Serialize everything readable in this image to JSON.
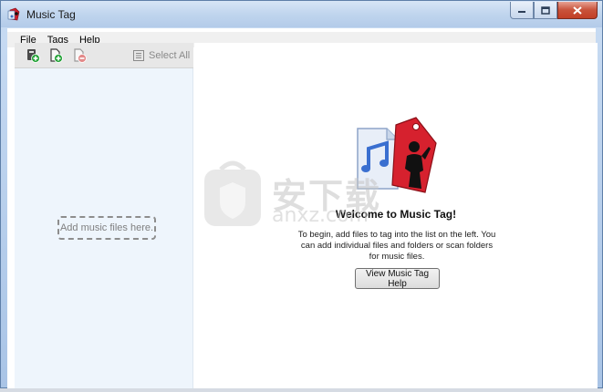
{
  "window": {
    "title": "Music Tag",
    "accent_color": "#b3cbe9",
    "close_color": "#c8523a"
  },
  "menu": {
    "items": [
      "File",
      "Tags",
      "Help"
    ]
  },
  "toolbar": {
    "icons": [
      "add-file-icon",
      "add-folder-icon",
      "remove-file-icon"
    ],
    "select_all_label": "Select All"
  },
  "left_pane": {
    "placeholder": "Add music files here."
  },
  "right_pane": {
    "welcome_title": "Welcome to Music Tag!",
    "description": "To begin, add files to tag into the list on the left. You can add individual files and folders or scan folders for music files.",
    "help_button": "View Music Tag Help"
  },
  "watermark": {
    "cn_text": "安下载",
    "en_text": "anxz.com"
  }
}
